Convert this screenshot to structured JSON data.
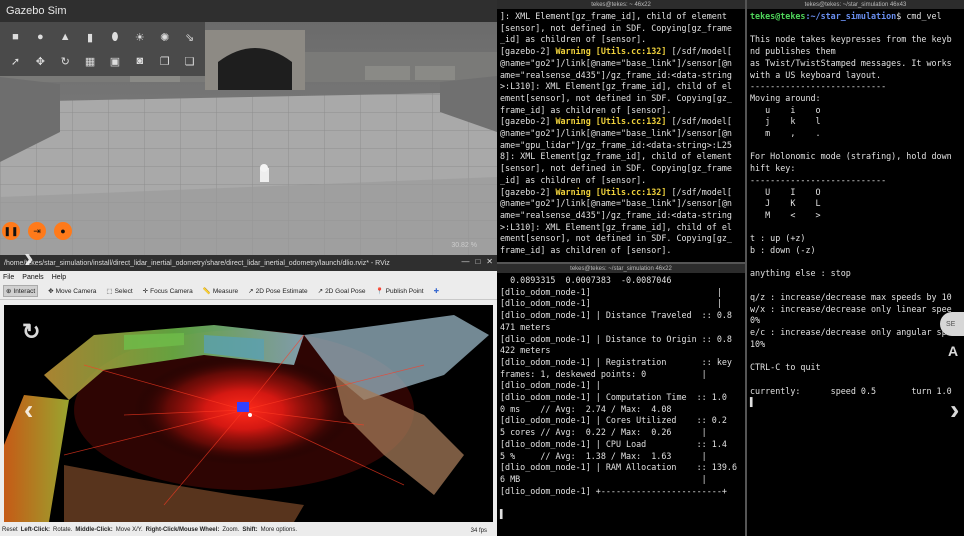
{
  "gazebo": {
    "title": "Gazebo Sim",
    "rtf": "30.82 %",
    "toolbar_icons": [
      "box-icon",
      "sphere-icon",
      "cone-icon",
      "cylinder-icon",
      "capsule-icon",
      "sun-icon",
      "spot-light-icon",
      "directional-light-icon",
      "select-icon",
      "translate-icon",
      "rotate-icon",
      "grid-icon",
      "image-icon",
      "camera-icon",
      "copy-icon",
      "paste-icon"
    ],
    "controls": {
      "play": "❚❚",
      "step": "⇥",
      "reset": "●"
    }
  },
  "rviz": {
    "title": "/home/tekes/star_simulation/install/direct_lidar_inertial_odometry/share/direct_lidar_inertial_odometry/launch/dlio.rviz* - RViz",
    "win_controls": [
      "—",
      "□",
      "✕"
    ],
    "menu": [
      "File",
      "Panels",
      "Help"
    ],
    "tools": [
      {
        "name": "interact",
        "label": "Interact",
        "icon": "⊕"
      },
      {
        "name": "move-camera",
        "label": "Move Camera",
        "icon": "✥"
      },
      {
        "name": "select",
        "label": "Select",
        "icon": "⬚"
      },
      {
        "name": "focus-camera",
        "label": "Focus Camera",
        "icon": "✛"
      },
      {
        "name": "measure",
        "label": "Measure",
        "icon": "📏"
      },
      {
        "name": "2d-pose-estimate",
        "label": "2D Pose Estimate",
        "icon": "↗"
      },
      {
        "name": "2d-goal-pose",
        "label": "2D Goal Pose",
        "icon": "↗"
      },
      {
        "name": "publish-point",
        "label": "Publish Point",
        "icon": "📍"
      }
    ],
    "status": {
      "reset": "Reset",
      "left_click_key": "Left-Click:",
      "left_click_val": "Rotate.",
      "middle_click_key": "Middle-Click:",
      "middle_click_val": "Move X/Y.",
      "right_click_key": "Right-Click/Mouse Wheel:",
      "right_click_val": "Zoom.",
      "shift_key": "Shift:",
      "shift_val": "More options."
    },
    "fps": "34 fps"
  },
  "term_gazebo": {
    "title": "tekes@tekes: ~ 46x22",
    "lines": [
      [
        {
          "t": "]: XML Element[gz_frame_id], child of element"
        }
      ],
      [
        {
          "t": "[sensor], not defined in SDF. Copying[gz_frame"
        }
      ],
      [
        {
          "t": "_id] as children of [sensor]."
        }
      ],
      [
        {
          "t": "[gazebo-2] "
        },
        {
          "t": "Warning [Utils.cc:132]",
          "c": "warn"
        },
        {
          "t": " [/sdf/model["
        }
      ],
      [
        {
          "t": "@name=\"go2\"]/link[@name=\"base_link\"]/sensor[@n"
        }
      ],
      [
        {
          "t": "ame=\"realsense_d435\"]/gz_frame_id:<data-string"
        }
      ],
      [
        {
          "t": ">:L310]: XML Element[gz_frame_id], child of el"
        }
      ],
      [
        {
          "t": "ement[sensor], not defined in SDF. Copying[gz_"
        }
      ],
      [
        {
          "t": "frame_id] as children of [sensor]."
        }
      ],
      [
        {
          "t": "[gazebo-2] "
        },
        {
          "t": "Warning [Utils.cc:132]",
          "c": "warn"
        },
        {
          "t": " [/sdf/model["
        }
      ],
      [
        {
          "t": "@name=\"go2\"]/link[@name=\"base_link\"]/sensor[@n"
        }
      ],
      [
        {
          "t": "ame=\"gpu_lidar\"]/gz_frame_id:<data-string>:L25"
        }
      ],
      [
        {
          "t": "8]: XML Element[gz_frame_id], child of element"
        }
      ],
      [
        {
          "t": "[sensor], not defined in SDF. Copying[gz_frame"
        }
      ],
      [
        {
          "t": "_id] as children of [sensor]."
        }
      ],
      [
        {
          "t": "[gazebo-2] "
        },
        {
          "t": "Warning [Utils.cc:132]",
          "c": "warn"
        },
        {
          "t": " [/sdf/model["
        }
      ],
      [
        {
          "t": "@name=\"go2\"]/link[@name=\"base_link\"]/sensor[@n"
        }
      ],
      [
        {
          "t": "ame=\"realsense_d435\"]/gz_frame_id:<data-string"
        }
      ],
      [
        {
          "t": ">:L310]: XML Element[gz_frame_id], child of el"
        }
      ],
      [
        {
          "t": "ement[sensor], not defined in SDF. Copying[gz_"
        }
      ],
      [
        {
          "t": "frame_id] as children of [sensor]."
        }
      ]
    ]
  },
  "term_dlio": {
    "title": "tekes@tekes: ~/star_simulation 46x22",
    "lines": [
      "  0.0893315  0.0007383  -0.0087046",
      "[dlio_odom_node-1]                         |",
      "[dlio_odom_node-1]                         |",
      "[dlio_odom_node-1] | Distance Traveled  :: 0.8",
      "471 meters",
      "[dlio_odom_node-1] | Distance to Origin :: 0.8",
      "422 meters",
      "[dlio_odom_node-1] | Registration       :: key",
      "frames: 1, deskewed points: 0           |",
      "[dlio_odom_node-1] |",
      "[dlio_odom_node-1] | Computation Time  :: 1.0",
      "0 ms    // Avg:  2.74 / Max:  4.08",
      "[dlio_odom_node-1] | Cores Utilized    :: 0.2",
      "5 cores // Avg:  0.22 / Max:  0.26      |",
      "[dlio_odom_node-1] | CPU Load          :: 1.4",
      "5 %     // Avg:  1.38 / Max:  1.63      |",
      "[dlio_odom_node-1] | RAM Allocation    :: 139.6",
      "6 MB                                    |",
      "[dlio_odom_node-1] +------------------------+",
      "",
      "▌"
    ]
  },
  "term_teleop": {
    "title": "tekes@tekes: ~/star_simulation 46x43",
    "prompt_user": "tekes@tekes",
    "prompt_path": ":~/star_simulation",
    "prompt_cmd": "$ cmd_vel",
    "lines": [
      "",
      "This node takes keypresses from the keyb",
      "nd publishes them",
      "as Twist/TwistStamped messages. It works",
      "with a US keyboard layout.",
      "---------------------------",
      "Moving around:",
      "   u    i    o",
      "   j    k    l",
      "   m    ,    .",
      "",
      "For Holonomic mode (strafing), hold down",
      "hift key:",
      "---------------------------",
      "   U    I    O",
      "   J    K    L",
      "   M    <    >",
      "",
      "t : up (+z)",
      "b : down (-z)",
      "",
      "anything else : stop",
      "",
      "q/z : increase/decrease max speeds by 10",
      "w/x : increase/decrease only linear spee",
      "0%",
      "e/c : increase/decrease only angular spe",
      "10%",
      "",
      "CTRL-C to quit",
      "",
      "currently:      speed 0.5       turn 1.0",
      "▌"
    ]
  },
  "overlay": {
    "pill_label": "SE",
    "side_letter": "A",
    "refresh": "↻",
    "next": "›",
    "prev": "‹"
  }
}
